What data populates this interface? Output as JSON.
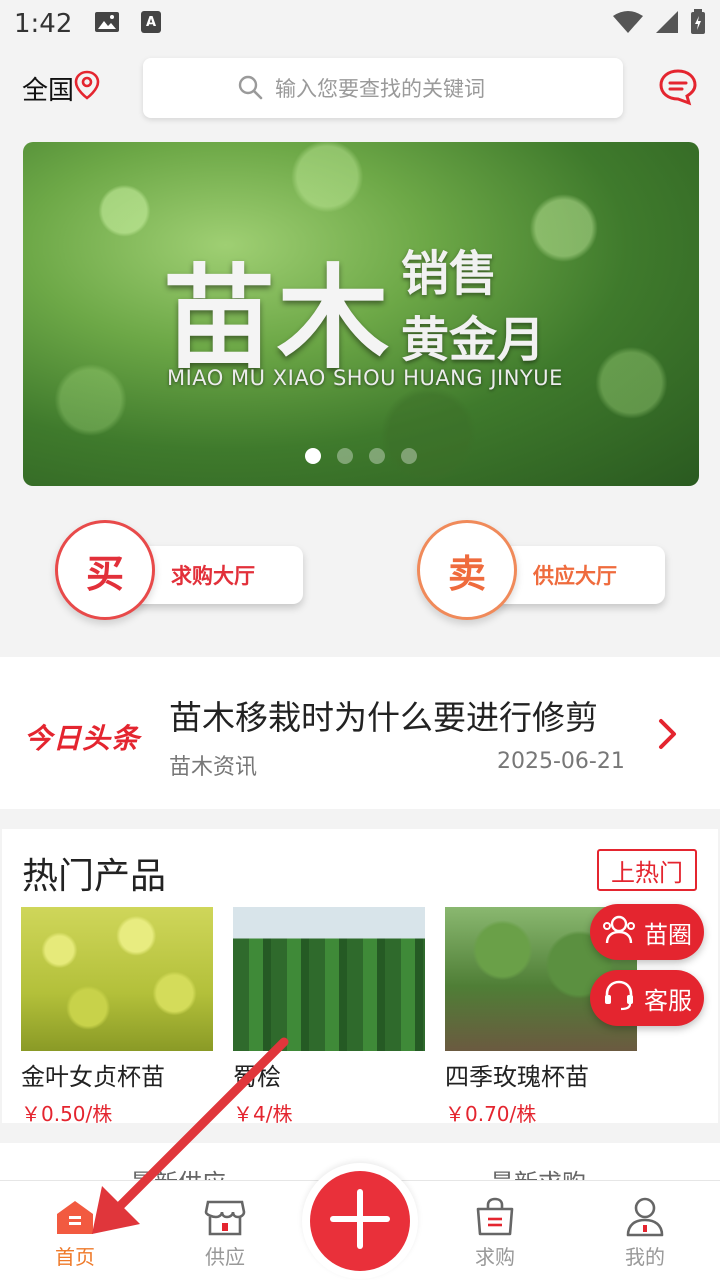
{
  "status_bar": {
    "time": "1:42"
  },
  "header": {
    "region": "全国",
    "search_placeholder": "输入您要查找的关键词"
  },
  "banner": {
    "title_big": "苗木",
    "title_line1": "销售",
    "title_line2": "黄金月",
    "pinyin": "MIAO MU XIAO SHOU HUANG JINYUE",
    "slide_count": 4,
    "active_slide": 1
  },
  "actions": {
    "buy": {
      "badge": "买",
      "label": "求购大厅"
    },
    "sell": {
      "badge": "卖",
      "label": "供应大厅"
    }
  },
  "headline": {
    "logo": "今日头条",
    "title": "苗木移栽时为什么要进行修剪",
    "category": "苗木资讯",
    "date": "2025-06-21"
  },
  "hot_products": {
    "heading": "热门产品",
    "promote_label": "上热门",
    "items": [
      {
        "name": "金叶女贞杯苗",
        "price": "￥0.50/株"
      },
      {
        "name": "蜀桧",
        "price": "￥4/株"
      },
      {
        "name": "四季玫瑰杯苗",
        "price": "￥0.70/株"
      }
    ]
  },
  "floating": {
    "circle_label": "苗圈",
    "service_label": "客服"
  },
  "sections_peek": {
    "left": "最新供应",
    "right": "最新求购"
  },
  "bottom_nav": {
    "home": "首页",
    "supply": "供应",
    "purchase": "求购",
    "mine": "我的"
  },
  "colors": {
    "brand_red": "#e4252f",
    "active_orange": "#ef7a2a"
  }
}
